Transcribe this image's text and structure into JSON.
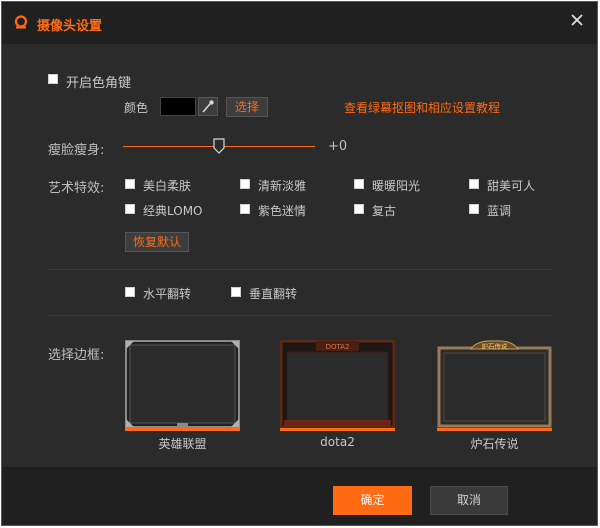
{
  "window": {
    "title": "摄像头设置",
    "accent": "#ff6a13"
  },
  "chroma": {
    "toggle_label": "开启色角键",
    "checked": false,
    "color_label": "颜色",
    "color_value": "#000000",
    "select_label": "选择",
    "tutorial_link": "查看绿幕抠图和相应设置教程"
  },
  "slim": {
    "label": "瘦脸瘦身:",
    "value_text": "+0",
    "level": 0.5
  },
  "effects": {
    "label": "艺术特效:",
    "items": [
      {
        "label": "美白柔肤",
        "checked": false
      },
      {
        "label": "清新淡雅",
        "checked": false
      },
      {
        "label": "暖暖阳光",
        "checked": false
      },
      {
        "label": "甜美可人",
        "checked": false
      },
      {
        "label": "经典LOMO",
        "checked": false
      },
      {
        "label": "紫色迷情",
        "checked": false
      },
      {
        "label": "复古",
        "checked": false
      },
      {
        "label": "蓝调",
        "checked": false
      }
    ],
    "reset_label": "恢复默认"
  },
  "flip": {
    "horizontal_label": "水平翻转",
    "vertical_label": "垂直翻转"
  },
  "borders": {
    "label": "选择边框:",
    "items": [
      {
        "label": "英雄联盟"
      },
      {
        "label": "dota2",
        "badge": "DOTA2"
      },
      {
        "label": "炉石传说",
        "badge": "炉石传说"
      }
    ]
  },
  "footer": {
    "ok_label": "确定",
    "cancel_label": "取消"
  }
}
